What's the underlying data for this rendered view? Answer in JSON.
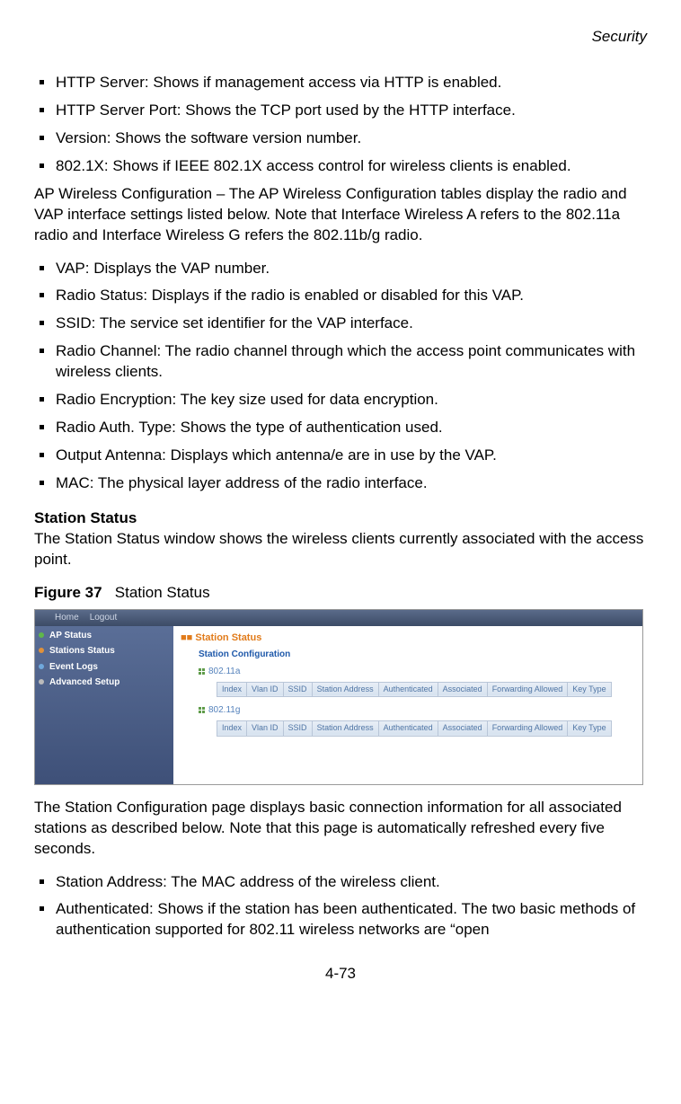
{
  "header": {
    "section": "Security"
  },
  "bullets_a": [
    "HTTP Server: Shows if management access via HTTP is enabled.",
    "HTTP Server Port: Shows the TCP port used by the HTTP interface.",
    "Version: Shows the software version number.",
    "802.1X: Shows if IEEE 802.1X access control for wireless clients is enabled."
  ],
  "para_ap": "AP Wireless Configuration – The AP Wireless Configuration tables display the radio and VAP interface settings listed below. Note that Interface Wireless A refers to the 802.11a radio and Interface Wireless G refers the 802.11b/g radio.",
  "bullets_b": [
    "VAP: Displays the VAP number.",
    "Radio Status: Displays if the radio is enabled or disabled for this VAP.",
    "SSID: The service set identifier for the VAP interface.",
    "Radio Channel: The radio channel through which the access point communicates with wireless clients.",
    "Radio Encryption: The key size used for data encryption.",
    "Radio Auth. Type: Shows the type of authentication used.",
    "Output Antenna: Displays which antenna/e are in use by the VAP.",
    "MAC: The physical layer address of the radio interface."
  ],
  "station": {
    "heading": "Station Status",
    "intro": "The Station Status window shows the wireless clients currently associated with the access point."
  },
  "figure": {
    "label": "Figure 37",
    "caption": "Station Status"
  },
  "screenshot": {
    "top": {
      "home": "Home",
      "logout": "Logout"
    },
    "sidebar": [
      "AP Status",
      "Stations Status",
      "Event Logs",
      "Advanced Setup"
    ],
    "title": "Station Status",
    "subtitle": "Station Configuration",
    "radio_a": "802.11a",
    "radio_g": "802.11g",
    "cols": {
      "index": "Index",
      "vlan": "Vlan ID",
      "ssid": "SSID",
      "staddr": "Station Address",
      "auth": "Authenticated",
      "assoc": "Associated",
      "fwd": "Forwarding Allowed",
      "ktype": "Key Type"
    }
  },
  "para_after": "The Station Configuration page displays basic connection information for all associated stations as described below. Note that this page is automatically refreshed every five seconds.",
  "bullets_c": [
    "Station Address: The MAC address of the wireless client.",
    "Authenticated: Shows if the station has been authenticated. The two basic methods of authentication supported for 802.11 wireless networks are “open"
  ],
  "pagenum": "4-73"
}
